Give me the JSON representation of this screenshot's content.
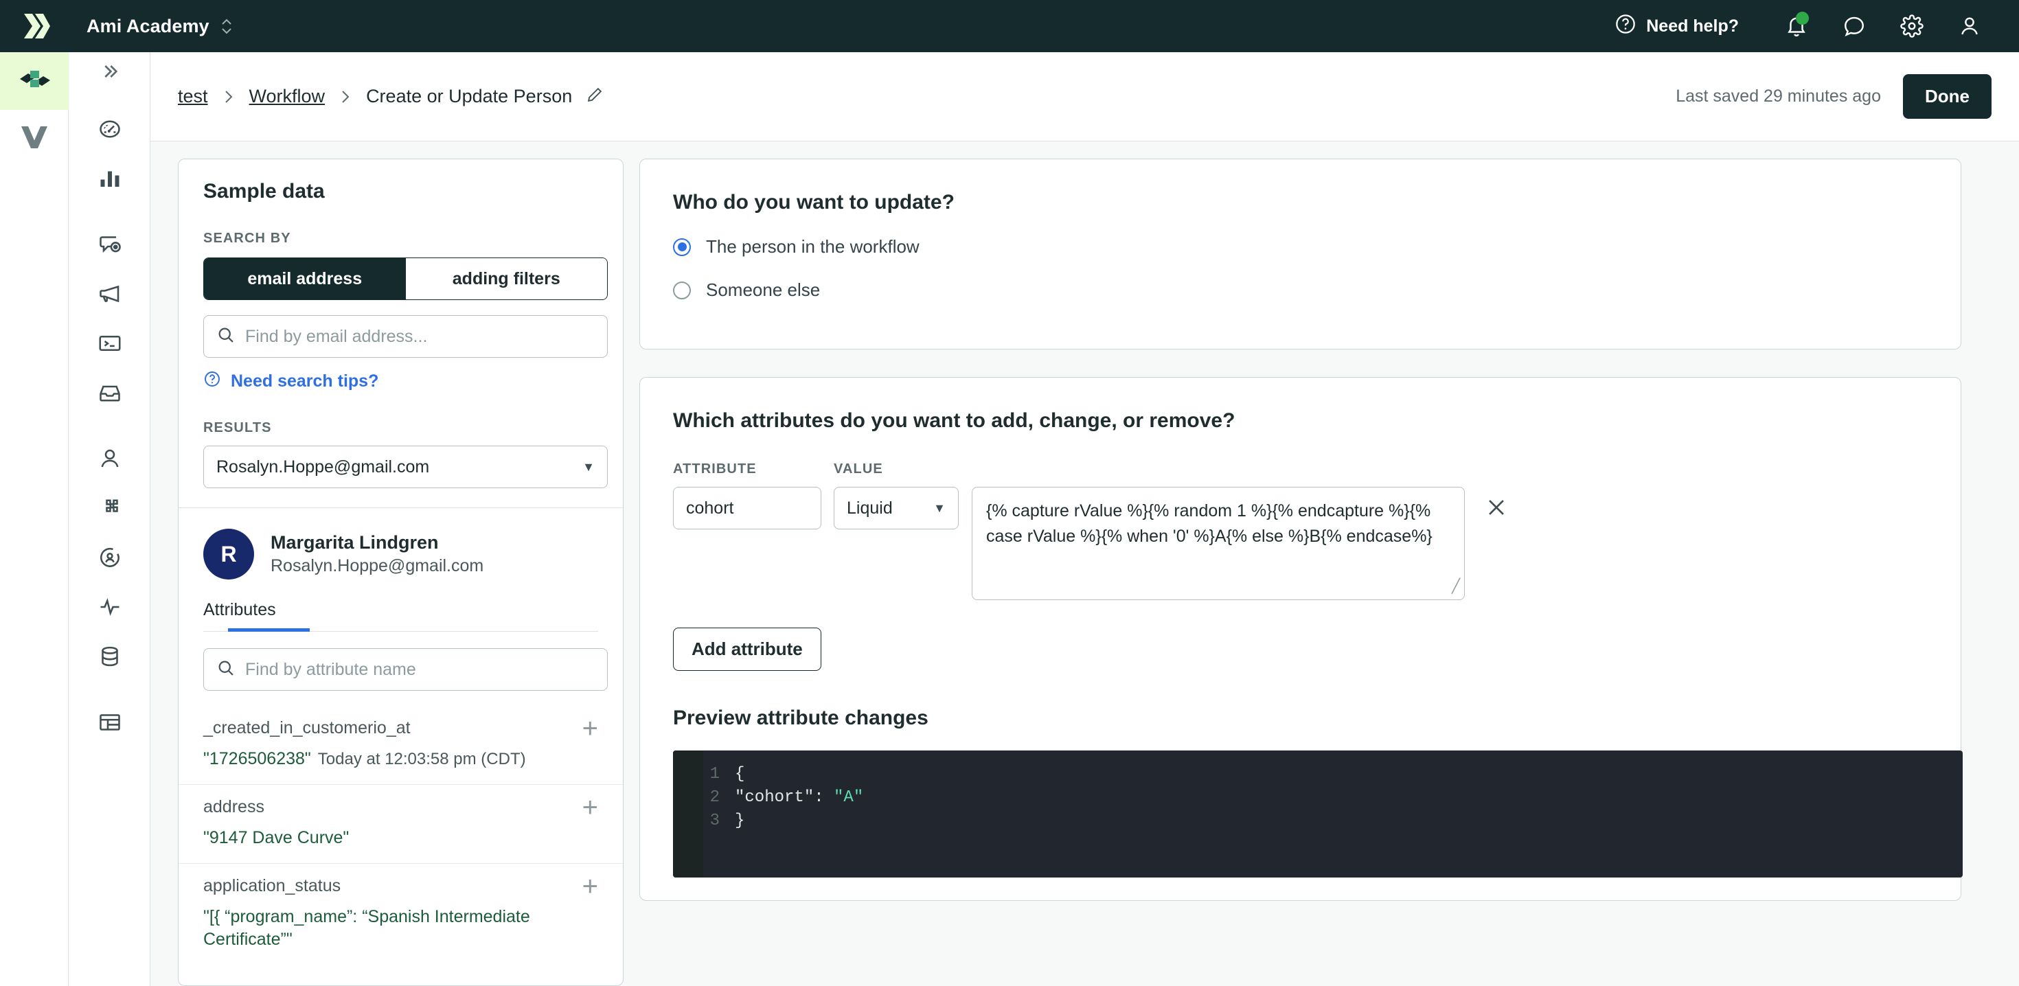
{
  "topbar": {
    "workspace": "Ami Academy",
    "need_help": "Need help?",
    "icons": [
      "help-circle-icon",
      "bell-icon",
      "chat-icon",
      "gear-icon",
      "user-icon"
    ],
    "notification_dot_color": "#2eab48",
    "background": "#142a2c"
  },
  "rail": {
    "items": [
      {
        "name": "journeys-logo-icon",
        "active": true
      },
      {
        "name": "data-pipelines-icon",
        "active": false
      }
    ]
  },
  "nav": {
    "items": [
      "chevrons-right-icon",
      "dashboard-icon",
      "analytics-icon",
      "message-preview-icon",
      "broadcast-icon",
      "api-console-icon",
      "inbox-icon",
      "people-icon",
      "integrations-icon",
      "segments-icon",
      "activity-icon",
      "data-icon",
      "collections-icon"
    ]
  },
  "breadcrumb": {
    "items": [
      {
        "label": "test",
        "link": true
      },
      {
        "label": "Workflow",
        "link": true
      },
      {
        "label": "Create or Update Person",
        "link": false
      }
    ],
    "separator": "›",
    "edit_icon": "pencil-icon",
    "saved_status": "Last saved 29 minutes ago",
    "done_label": "Done"
  },
  "sample_panel": {
    "title": "Sample data",
    "search_by_label": "SEARCH BY",
    "segments": [
      {
        "label": "email address",
        "active": true
      },
      {
        "label": "adding filters",
        "active": false
      }
    ],
    "search_placeholder": "Find by email address...",
    "tips_label": "Need search tips?",
    "tips_icon": "question-circle-icon",
    "results_label": "RESULTS",
    "result_selected": "Rosalyn.Hoppe@gmail.com",
    "person": {
      "initial": "R",
      "name": "Margarita Lindgren",
      "email": "Rosalyn.Hoppe@gmail.com",
      "avatar_color": "#17296b"
    },
    "tabs": [
      {
        "label": "Attributes",
        "active": true
      }
    ],
    "attribute_search_placeholder": "Find by attribute name",
    "attributes": [
      {
        "name": "_created_in_customerio_at",
        "value": "\"1726506238\"",
        "timestamp": "Today at 12:03:58 pm (CDT)"
      },
      {
        "name": "address",
        "value": "\"9147 Dave Curve\"",
        "timestamp": ""
      },
      {
        "name": "application_status",
        "value": "\"[{ “program_name”: “Spanish Intermediate Certificate”\"",
        "timestamp": ""
      }
    ]
  },
  "who_card": {
    "title": "Who do you want to update?",
    "options": [
      {
        "label": "The person in the workflow",
        "selected": true
      },
      {
        "label": "Someone else",
        "selected": false
      }
    ]
  },
  "attributes_card": {
    "title": "Which attributes do you want to add, change, or remove?",
    "attribute_label": "ATTRIBUTE",
    "value_label": "VALUE",
    "rows": [
      {
        "attribute": "cohort",
        "type": "Liquid",
        "value": "{% capture rValue %}{% random 1 %}{% endcapture %}{% case rValue %}{% when '0' %}A{% else %}B{% endcase%}",
        "remove_icon": "close-icon"
      }
    ],
    "add_attribute_label": "Add attribute",
    "preview_title": "Preview attribute changes",
    "preview_code": {
      "lines": [
        "1",
        "2",
        "3"
      ],
      "line1": "{",
      "line2_key": "  \"cohort\": ",
      "line2_val": "\"A\"",
      "line3": "}",
      "background": "#22262f",
      "string_color": "#5fdcae"
    }
  }
}
